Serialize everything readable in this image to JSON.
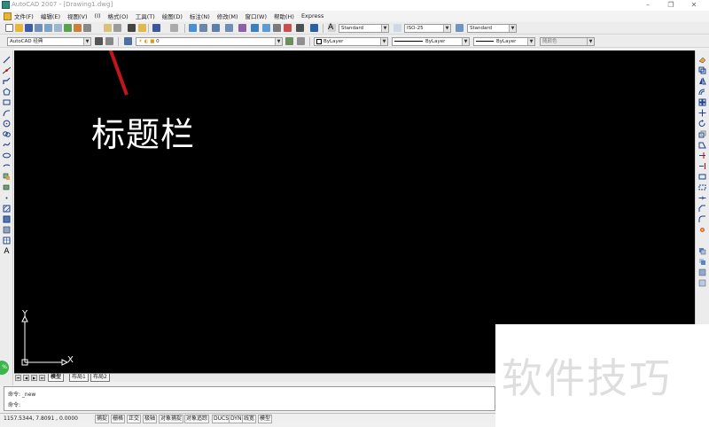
{
  "window": {
    "title": "AutoCAD 2007 - [Drawing1.dwg]"
  },
  "menu": {
    "items": [
      "文件(F)",
      "编辑(E)",
      "视图(V)",
      "(I)",
      "格式(O)",
      "工具(T)",
      "绘图(D)",
      "标注(N)",
      "修改(M)",
      "窗口(W)",
      "帮助(H)",
      "Express"
    ]
  },
  "toolbar": {
    "text_style": "Standard",
    "dim_style": "ISO-25",
    "table_style": "Standard",
    "workspace": "AutoCAD 经典",
    "layer": "0",
    "color": "ByLayer",
    "linetype": "ByLayer",
    "lineweight": "ByLayer",
    "plot_style": "随颜色"
  },
  "annotation": {
    "label": "标题栏",
    "arrow_color": "#c3161c"
  },
  "ucs": {
    "x": "X",
    "y": "Y"
  },
  "tabs": [
    "模型",
    "布局1",
    "布局2"
  ],
  "command_line": {
    "line1": "命令: _new",
    "line2": "命令:"
  },
  "status": {
    "coords": "1157.5344, 7.8091  , 0.0000",
    "buttons": [
      "捕捉",
      "栅格",
      "正交",
      "极轴",
      "对象捕捉",
      "对象追踪",
      "DUCS",
      "DYN",
      "线宽",
      "模型"
    ]
  },
  "watermark": "软件技巧",
  "colors": {
    "canvas": "#000000",
    "accent_green": "#3cb54a"
  }
}
